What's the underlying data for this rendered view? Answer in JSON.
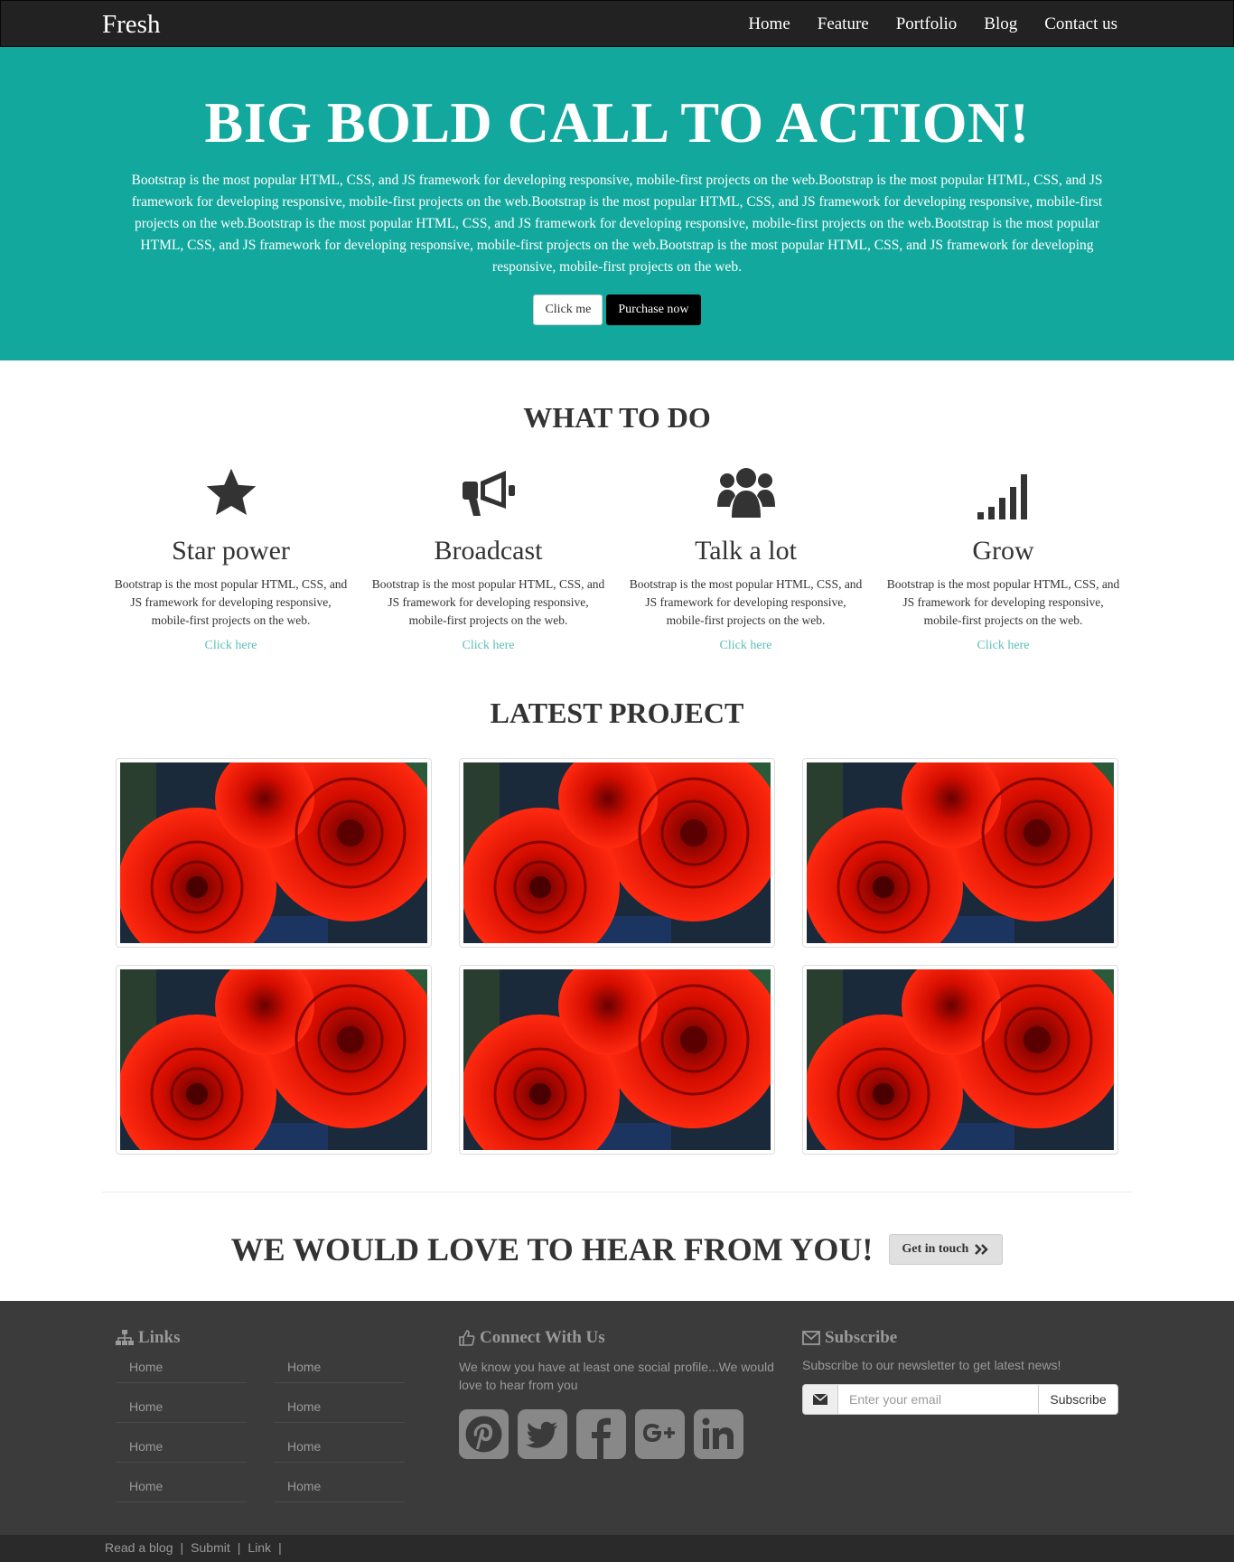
{
  "navbar": {
    "brand": "Fresh",
    "items": [
      "Home",
      "Feature",
      "Portfolio",
      "Blog",
      "Contact us"
    ]
  },
  "hero": {
    "title": "BIG BOLD CALL TO ACTION!",
    "text": "Bootstrap is the most popular HTML, CSS, and JS framework for developing responsive, mobile-first projects on the web.Bootstrap is the most popular HTML, CSS, and JS framework for developing responsive, mobile-first projects on the web.Bootstrap is the most popular HTML, CSS, and JS framework for developing responsive, mobile-first projects on the web.Bootstrap is the most popular HTML, CSS, and JS framework for developing responsive, mobile-first projects on the web.Bootstrap is the most popular HTML, CSS, and JS framework for developing responsive, mobile-first projects on the web.Bootstrap is the most popular HTML, CSS, and JS framework for developing responsive, mobile-first projects on the web.",
    "primary_button": "Click me",
    "secondary_button": "Purchase now"
  },
  "what_to_do": {
    "title": "WHAT TO DO",
    "features": [
      {
        "icon": "star-icon",
        "title": "Star power",
        "text": "Bootstrap is the most popular HTML, CSS, and JS framework for developing responsive, mobile-first projects on the web.",
        "link": "Click here"
      },
      {
        "icon": "bullhorn-icon",
        "title": "Broadcast",
        "text": "Bootstrap is the most popular HTML, CSS, and JS framework for developing responsive, mobile-first projects on the web.",
        "link": "Click here"
      },
      {
        "icon": "users-icon",
        "title": "Talk a lot",
        "text": "Bootstrap is the most popular HTML, CSS, and JS framework for developing responsive, mobile-first projects on the web.",
        "link": "Click here"
      },
      {
        "icon": "signal-icon",
        "title": "Grow",
        "text": "Bootstrap is the most popular HTML, CSS, and JS framework for developing responsive, mobile-first projects on the web.",
        "link": "Click here"
      }
    ]
  },
  "latest_project": {
    "title": "LATEST PROJECT",
    "image_count": 6
  },
  "contact": {
    "title": "WE WOULD LOVE TO HEAR FROM YOU!",
    "button": "Get in touch"
  },
  "footer": {
    "links": {
      "title": "Links",
      "icon": "sitemap-icon",
      "col1": [
        "Home",
        "Home",
        "Home",
        "Home"
      ],
      "col2": [
        "Home",
        "Home",
        "Home",
        "Home"
      ]
    },
    "connect": {
      "title": "Connect With Us",
      "icon": "thumbs-up-icon",
      "text": "We know you have at least one social profile...We would love to hear from you",
      "socials": [
        "pinterest-icon",
        "twitter-icon",
        "facebook-icon",
        "google-plus-icon",
        "linkedin-icon"
      ]
    },
    "subscribe": {
      "title": "Subscribe",
      "icon": "envelope-icon",
      "text": "Subscribe to our newsletter to get latest news!",
      "placeholder": "Enter your email",
      "button": "Subscribe"
    },
    "bottom_links": [
      "Read a blog",
      "Submit",
      "Link"
    ]
  },
  "colors": {
    "hero": "#13a89e",
    "navbar": "#222222",
    "footer": "#3b3b3b",
    "bottom_bar": "#2a2a2a",
    "link": "#5bc0b8"
  }
}
